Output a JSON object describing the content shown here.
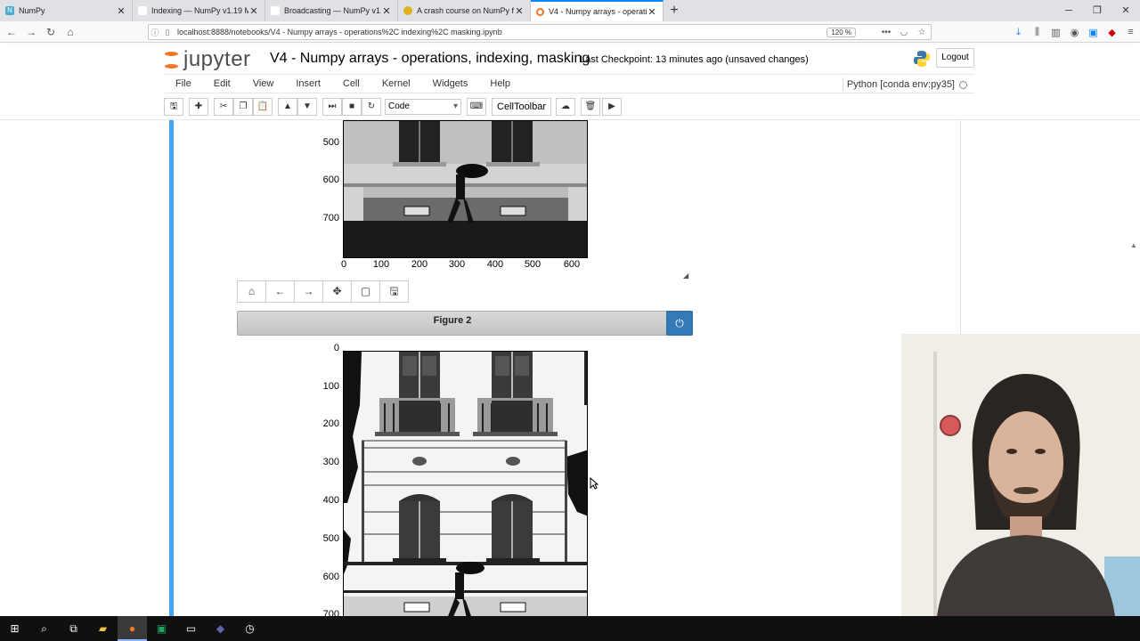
{
  "browser": {
    "tabs": [
      {
        "title": "NumPy",
        "favicon": "numpy-icon",
        "active": false
      },
      {
        "title": "Indexing — NumPy v1.19 Manual",
        "favicon": "numpy-icon",
        "active": false
      },
      {
        "title": "Broadcasting — NumPy v1.19 Man",
        "favicon": "numpy-icon",
        "active": false
      },
      {
        "title": "A crash course on NumPy for i",
        "favicon": "globe-icon",
        "active": false
      },
      {
        "title": "V4 - Numpy arrays - operations",
        "favicon": "jupyter-icon",
        "active": true
      }
    ],
    "url": "localhost:8888/notebooks/V4 - Numpy arrays - operations%2C indexing%2C masking.ipynb",
    "zoom": "120 %"
  },
  "jupyter": {
    "logo_text": "jupyter",
    "notebook_name": "V4 - Numpy arrays - operations, indexing, masking",
    "checkpoint": "Last Checkpoint: 13 minutes ago  (unsaved changes)",
    "logout_label": "Logout",
    "menu": [
      "File",
      "Edit",
      "View",
      "Insert",
      "Cell",
      "Kernel",
      "Widgets",
      "Help"
    ],
    "kernel_name": "Python [conda env:py35]",
    "cell_type": "Code",
    "celltoolbar_label": "CellToolbar"
  },
  "figure1": {
    "y_ticks": [
      "500",
      "600",
      "700"
    ],
    "x_ticks": [
      "0",
      "100",
      "200",
      "300",
      "400",
      "500",
      "600"
    ]
  },
  "figure2": {
    "title": "Figure 2",
    "y_ticks": [
      "0",
      "100",
      "200",
      "300",
      "400",
      "500",
      "600",
      "700"
    ]
  },
  "colors": {
    "selected_cell_bar": "#42a5f5",
    "power_button": "#337ab7",
    "jupyter_orange": "#f37626"
  }
}
